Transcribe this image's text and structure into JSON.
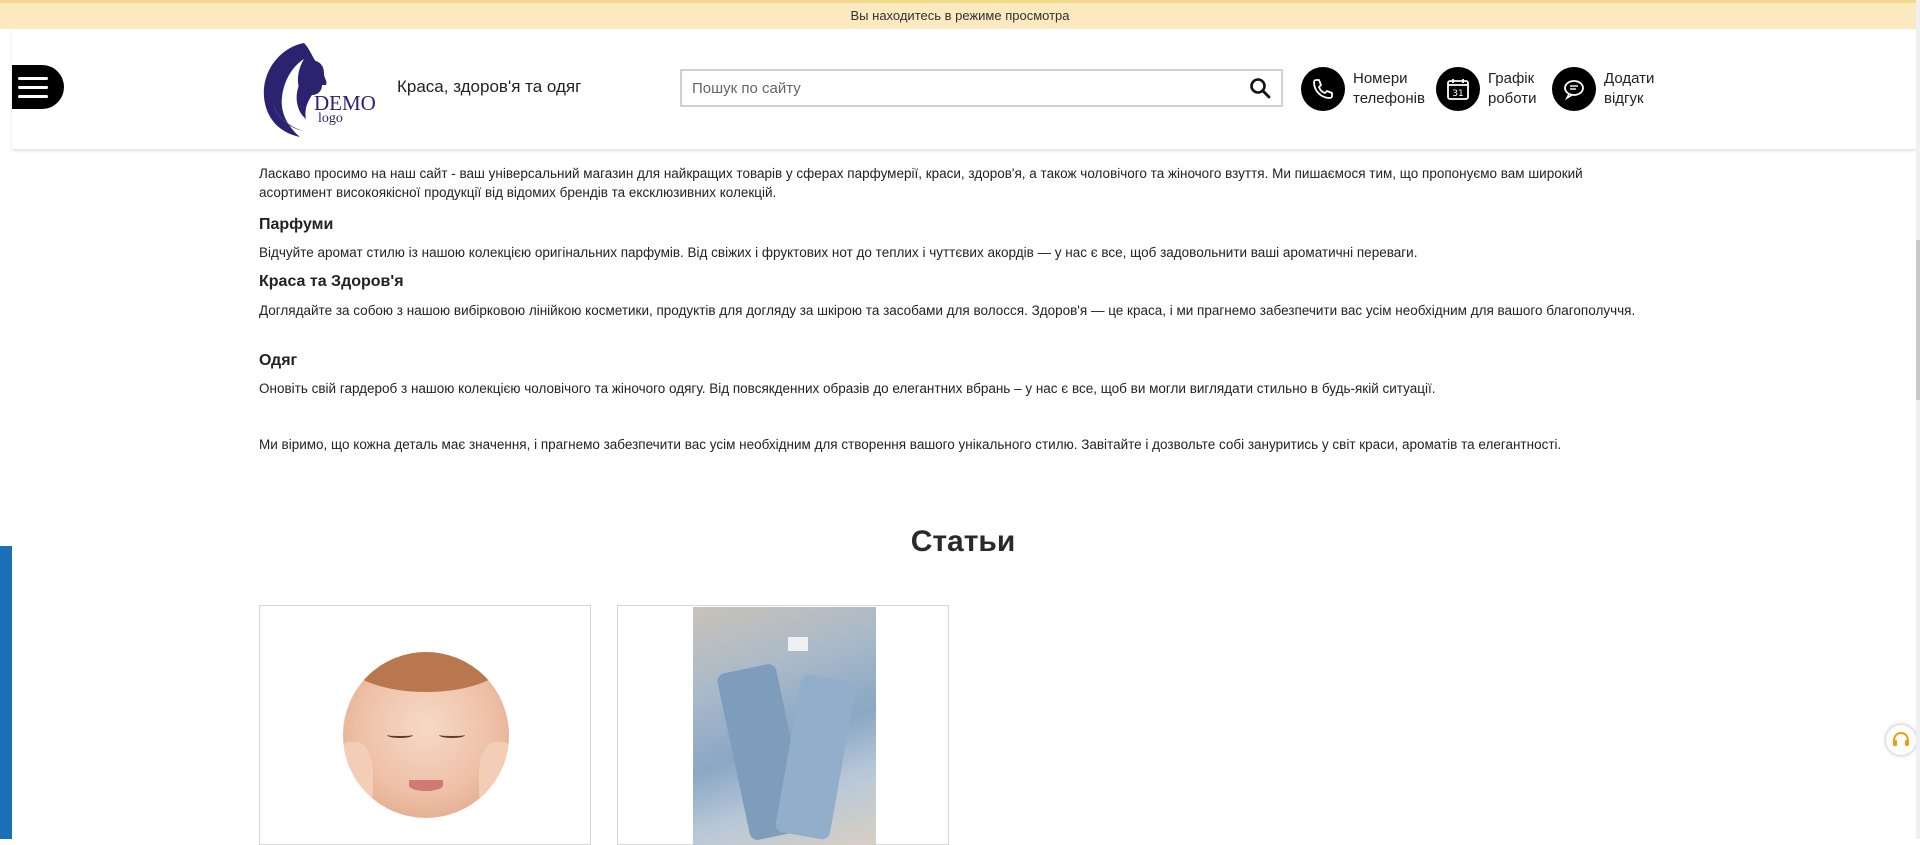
{
  "preview_banner": "Вы находитесь в режиме просмотра",
  "header": {
    "logo_text": "DEMO",
    "logo_sub": "logo",
    "tagline": "Краса, здоров'я та одяг",
    "search_placeholder": "Пошук по сайту",
    "items": [
      {
        "line1": "Номери",
        "line2": "телефонів",
        "icon": "phone-icon"
      },
      {
        "line1": "Графік",
        "line2": "роботи",
        "icon": "calendar-icon",
        "calendar_day": "31"
      },
      {
        "line1": "Додати",
        "line2": "відгук",
        "icon": "review-icon"
      }
    ]
  },
  "content": {
    "intro": "Ласкаво просимо на наш сайт - ваш універсальний магазин для найкращих товарів у сферах парфумерії, краси, здоров'я, а також чоловічого та жіночого взуття. Ми пишаємося тим, що пропонуємо вам широкий асортимент високоякісної продукції від відомих брендів та ексклюзивних колекцій.",
    "perfume_title": "Парфуми",
    "perfume_text": "Відчуйте аромат стилю із нашою колекцією оригінальних парфумів. Від свіжих і фруктових нот до теплих і чуттєвих акордів — у нас є все, щоб задовольнити ваші ароматичні переваги.",
    "beauty_title": "Краса та Здоров'я",
    "beauty_text": "Доглядайте за собою з нашою вибірковою лінійкою косметики, продуктів для догляду за шкірою та засобами для волосся. Здоров'я — це краса, і ми прагнемо забезпечити вас усім необхідним для вашого благополуччя.",
    "clothing_title": "Одяг",
    "clothing_text": "Оновіть свій гардероб з нашою колекцією чоловічого та жіночого одягу. Від повсякденних образів до елегантних вбрань – у нас є все, щоб ви могли виглядати стильно в будь-якій ситуації.",
    "final_text": "Ми віримо, що кожна деталь має значення, і прагнемо забезпечити вас усім необхідним для створення вашого унікального стилю. Завітайте і дозвольте собі зануритись у світ краси, ароматів та елегантності."
  },
  "articles": {
    "title": "Статьи"
  },
  "colors": {
    "banner_bg": "#fbe9c0",
    "logo": "#2c2370",
    "accent_left": "#1b6fb4",
    "help": "#f29b11"
  }
}
